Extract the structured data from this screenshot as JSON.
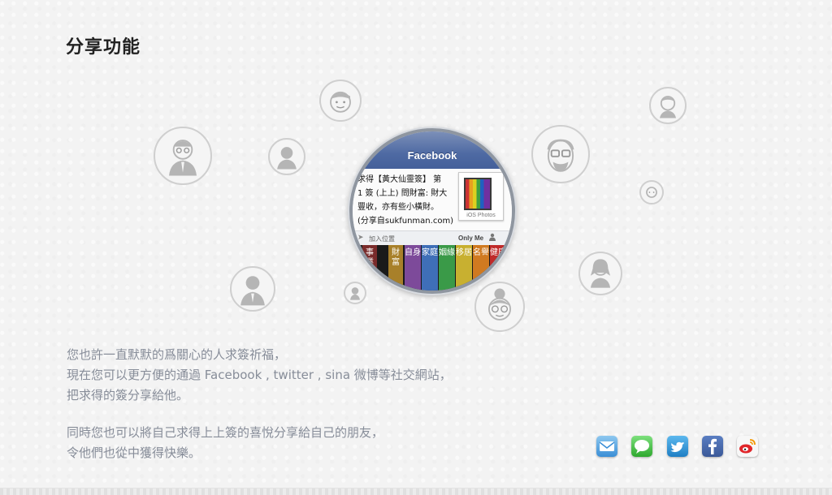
{
  "section": {
    "title": "分享功能"
  },
  "screenshot": {
    "nav_title": "Facebook",
    "post_lines": [
      "求得【黃大仙靈簽】 第",
      "1 簽 (上上) 問財富: 財大",
      "豐收，亦有些小橫財。",
      "(分享自sukfunman.com)"
    ],
    "photo_label": "iOS Photos",
    "location_label": "加入位置",
    "privacy_label": "Only Me",
    "book_spines": [
      "事業",
      "財富",
      "自身",
      "家庭",
      "姻緣",
      "移居",
      "名譽",
      "健康"
    ]
  },
  "description": {
    "paragraph1": [
      "您也許一直默默的爲關心的人求簽祈福，",
      "現在您可以更方便的通過 Facebook , twitter , sina 微博等社交網站，",
      "把求得的簽分享給他。"
    ],
    "paragraph2": [
      "同時您也可以將自己求得上上簽的喜悅分享給自己的朋友，",
      "令他們也從中獲得快樂。"
    ]
  },
  "share_icons": [
    "mail-icon",
    "messages-icon",
    "twitter-icon",
    "facebook-icon",
    "weibo-icon"
  ],
  "colors": {
    "background": "#f3f3f3",
    "title": "#222222",
    "body_text": "#878d99",
    "facebook_blue": "#4e6aa3",
    "twitter_blue": "#2c8fd6",
    "messages_green": "#3cc03c",
    "weibo_red": "#e0262a"
  }
}
